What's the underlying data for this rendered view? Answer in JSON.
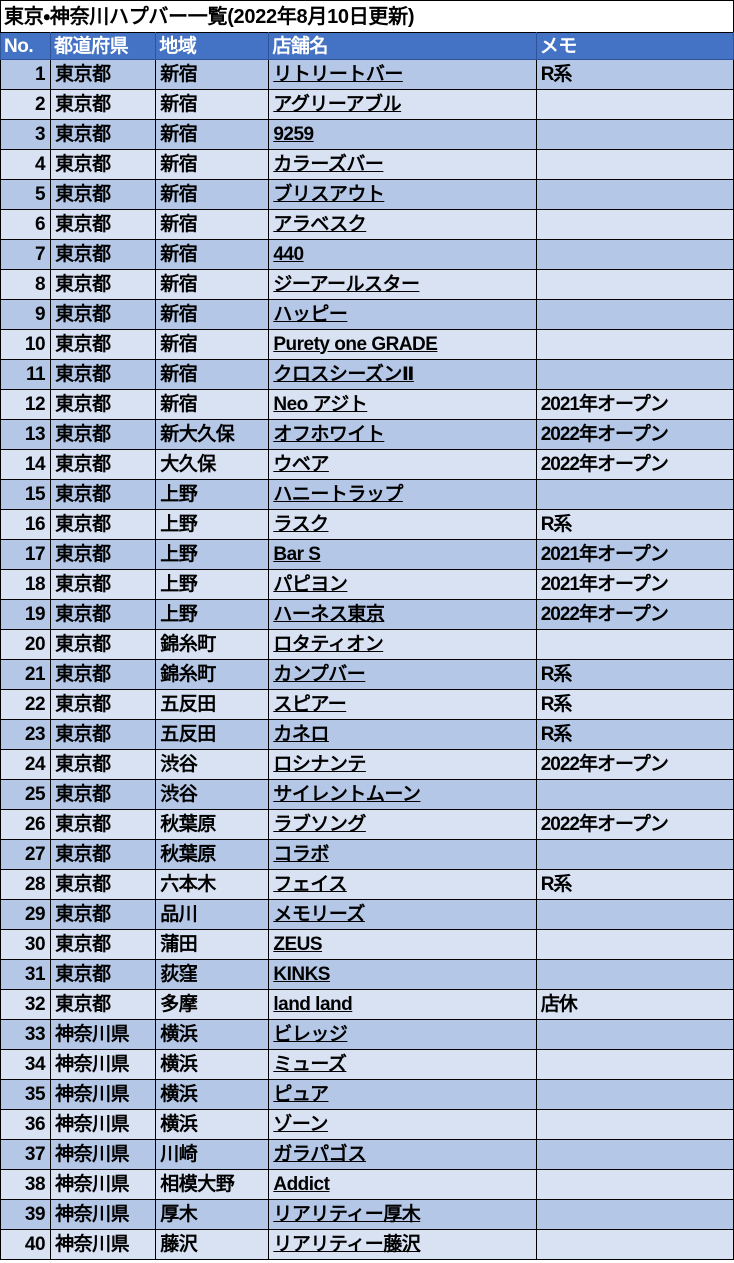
{
  "title": "東京・神奈川ハプバー一覧(2022年8月10日更新)",
  "colors": {
    "header_bg": "#4472C4",
    "header_text": "#FFFFFF",
    "row_odd_bg": "#B4C7E7",
    "row_even_bg": "#D9E2F3",
    "grid_line": "#000000",
    "page_bg": "#FFFFFF"
  },
  "columns": [
    {
      "key": "no",
      "label": "No."
    },
    {
      "key": "pref",
      "label": "都道府県"
    },
    {
      "key": "area",
      "label": "地域"
    },
    {
      "key": "shop",
      "label": "店舗名"
    },
    {
      "key": "memo",
      "label": "メモ"
    }
  ],
  "rows": [
    {
      "no": "1",
      "pref": "東京都",
      "area": "新宿",
      "shop": "リトリートバー",
      "memo": "R系"
    },
    {
      "no": "2",
      "pref": "東京都",
      "area": "新宿",
      "shop": "アグリーアブル",
      "memo": ""
    },
    {
      "no": "3",
      "pref": "東京都",
      "area": "新宿",
      "shop": "9259",
      "memo": ""
    },
    {
      "no": "4",
      "pref": "東京都",
      "area": "新宿",
      "shop": "カラーズバー",
      "memo": ""
    },
    {
      "no": "5",
      "pref": "東京都",
      "area": "新宿",
      "shop": "ブリスアウト",
      "memo": ""
    },
    {
      "no": "6",
      "pref": "東京都",
      "area": "新宿",
      "shop": "アラベスク",
      "memo": ""
    },
    {
      "no": "7",
      "pref": "東京都",
      "area": "新宿",
      "shop": "440",
      "memo": ""
    },
    {
      "no": "8",
      "pref": "東京都",
      "area": "新宿",
      "shop": "ジーアールスター",
      "memo": ""
    },
    {
      "no": "9",
      "pref": "東京都",
      "area": "新宿",
      "shop": "ハッピー",
      "memo": ""
    },
    {
      "no": "10",
      "pref": "東京都",
      "area": "新宿",
      "shop": "Purety one GRADE",
      "memo": ""
    },
    {
      "no": "11",
      "pref": "東京都",
      "area": "新宿",
      "shop": "クロスシーズンⅡ",
      "memo": ""
    },
    {
      "no": "12",
      "pref": "東京都",
      "area": "新宿",
      "shop": "Neo アジト",
      "memo": "2021年オープン"
    },
    {
      "no": "13",
      "pref": "東京都",
      "area": "新大久保",
      "shop": "オフホワイト",
      "memo": "2022年オープン"
    },
    {
      "no": "14",
      "pref": "東京都",
      "area": "大久保",
      "shop": "ウベア",
      "memo": "2022年オープン"
    },
    {
      "no": "15",
      "pref": "東京都",
      "area": "上野",
      "shop": "ハニートラップ",
      "memo": ""
    },
    {
      "no": "16",
      "pref": "東京都",
      "area": "上野",
      "shop": "ラスク",
      "memo": "R系"
    },
    {
      "no": "17",
      "pref": "東京都",
      "area": "上野",
      "shop": "Bar S",
      "memo": "2021年オープン"
    },
    {
      "no": "18",
      "pref": "東京都",
      "area": "上野",
      "shop": "パピヨン",
      "memo": "2021年オープン"
    },
    {
      "no": "19",
      "pref": "東京都",
      "area": "上野",
      "shop": "ハーネス東京",
      "memo": "2022年オープン"
    },
    {
      "no": "20",
      "pref": "東京都",
      "area": "錦糸町",
      "shop": "ロタティオン",
      "memo": ""
    },
    {
      "no": "21",
      "pref": "東京都",
      "area": "錦糸町",
      "shop": "カンプバー",
      "memo": "R系"
    },
    {
      "no": "22",
      "pref": "東京都",
      "area": "五反田",
      "shop": "スピアー",
      "memo": "R系"
    },
    {
      "no": "23",
      "pref": "東京都",
      "area": "五反田",
      "shop": "カネロ",
      "memo": "R系"
    },
    {
      "no": "24",
      "pref": "東京都",
      "area": "渋谷",
      "shop": "ロシナンテ",
      "memo": "2022年オープン"
    },
    {
      "no": "25",
      "pref": "東京都",
      "area": "渋谷",
      "shop": "サイレントムーン",
      "memo": ""
    },
    {
      "no": "26",
      "pref": "東京都",
      "area": "秋葉原",
      "shop": "ラブソング",
      "memo": "2022年オープン"
    },
    {
      "no": "27",
      "pref": "東京都",
      "area": "秋葉原",
      "shop": "コラボ",
      "memo": ""
    },
    {
      "no": "28",
      "pref": "東京都",
      "area": "六本木",
      "shop": "フェイス",
      "memo": "R系"
    },
    {
      "no": "29",
      "pref": "東京都",
      "area": "品川",
      "shop": "メモリーズ",
      "memo": ""
    },
    {
      "no": "30",
      "pref": "東京都",
      "area": "蒲田",
      "shop": "ZEUS",
      "memo": ""
    },
    {
      "no": "31",
      "pref": "東京都",
      "area": "荻窪",
      "shop": "KINKS",
      "memo": ""
    },
    {
      "no": "32",
      "pref": "東京都",
      "area": "多摩",
      "shop": "land land",
      "memo": "店休"
    },
    {
      "no": "33",
      "pref": "神奈川県",
      "area": "横浜",
      "shop": "ビレッジ",
      "memo": ""
    },
    {
      "no": "34",
      "pref": "神奈川県",
      "area": "横浜",
      "shop": "ミューズ",
      "memo": ""
    },
    {
      "no": "35",
      "pref": "神奈川県",
      "area": "横浜",
      "shop": "ピュア",
      "memo": ""
    },
    {
      "no": "36",
      "pref": "神奈川県",
      "area": "横浜",
      "shop": "ゾーン",
      "memo": ""
    },
    {
      "no": "37",
      "pref": "神奈川県",
      "area": "川崎",
      "shop": "ガラパゴス",
      "memo": ""
    },
    {
      "no": "38",
      "pref": "神奈川県",
      "area": "相模大野",
      "shop": "Addict",
      "memo": ""
    },
    {
      "no": "39",
      "pref": "神奈川県",
      "area": "厚木",
      "shop": "リアリティー厚木",
      "memo": ""
    },
    {
      "no": "40",
      "pref": "神奈川県",
      "area": "藤沢",
      "shop": "リアリティー藤沢",
      "memo": ""
    }
  ]
}
